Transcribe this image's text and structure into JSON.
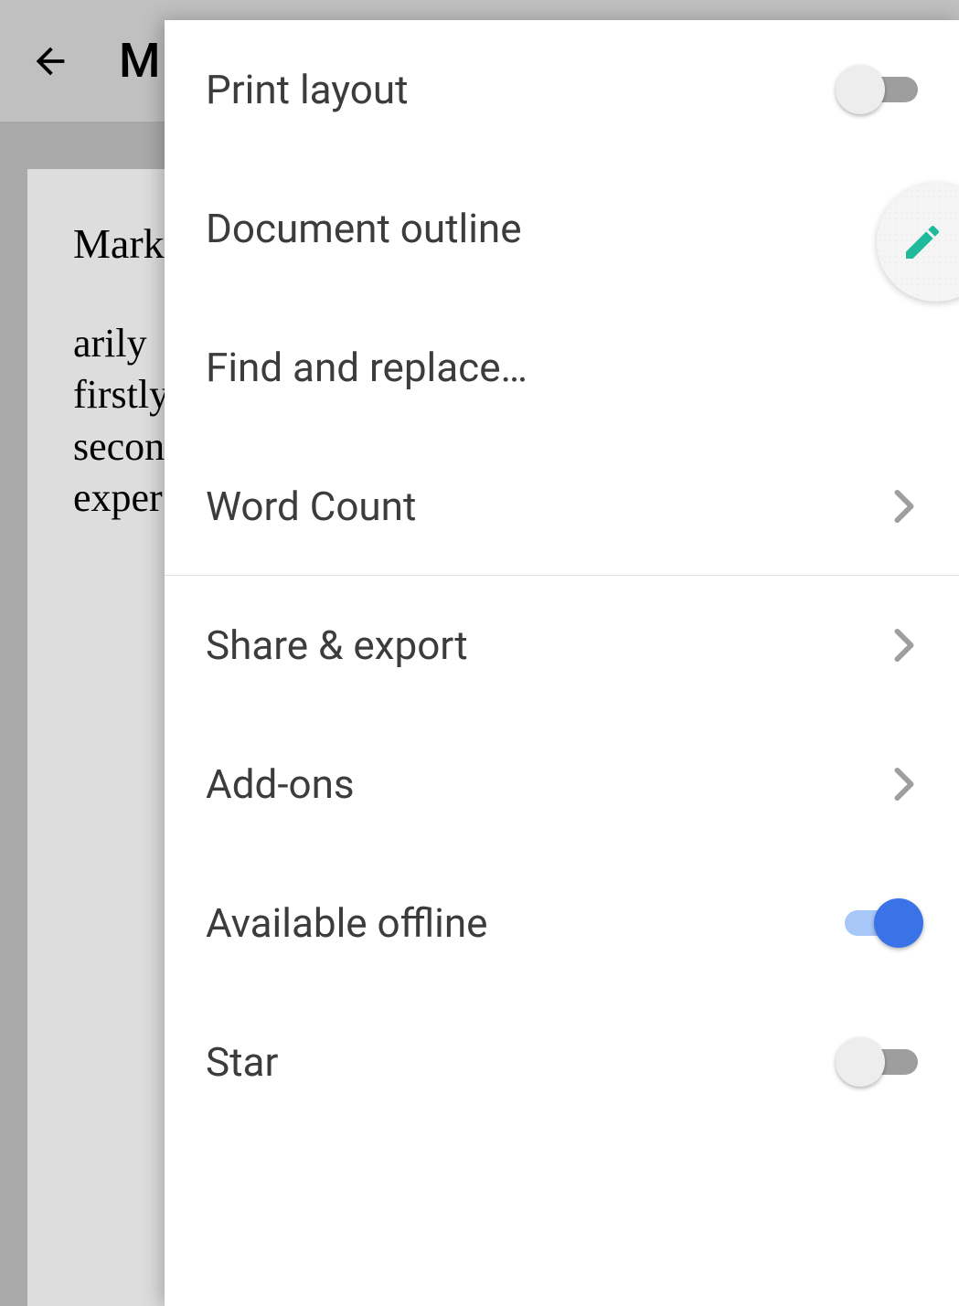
{
  "header": {
    "titleVisible": "M"
  },
  "document": {
    "heading": "Mark",
    "lines": [
      "arily",
      "firstly",
      "secon",
      "exper"
    ]
  },
  "menu": {
    "items": [
      {
        "label": "Print layout",
        "type": "toggle",
        "value": false
      },
      {
        "label": "Document outline",
        "type": "action"
      },
      {
        "label": "Find and replace…",
        "type": "action"
      },
      {
        "label": "Word Count",
        "type": "submenu",
        "divider": true
      },
      {
        "label": "Share & export",
        "type": "submenu"
      },
      {
        "label": "Add-ons",
        "type": "submenu"
      },
      {
        "label": "Available offline",
        "type": "toggle",
        "value": true
      },
      {
        "label": "Star",
        "type": "toggle",
        "value": false
      }
    ]
  }
}
